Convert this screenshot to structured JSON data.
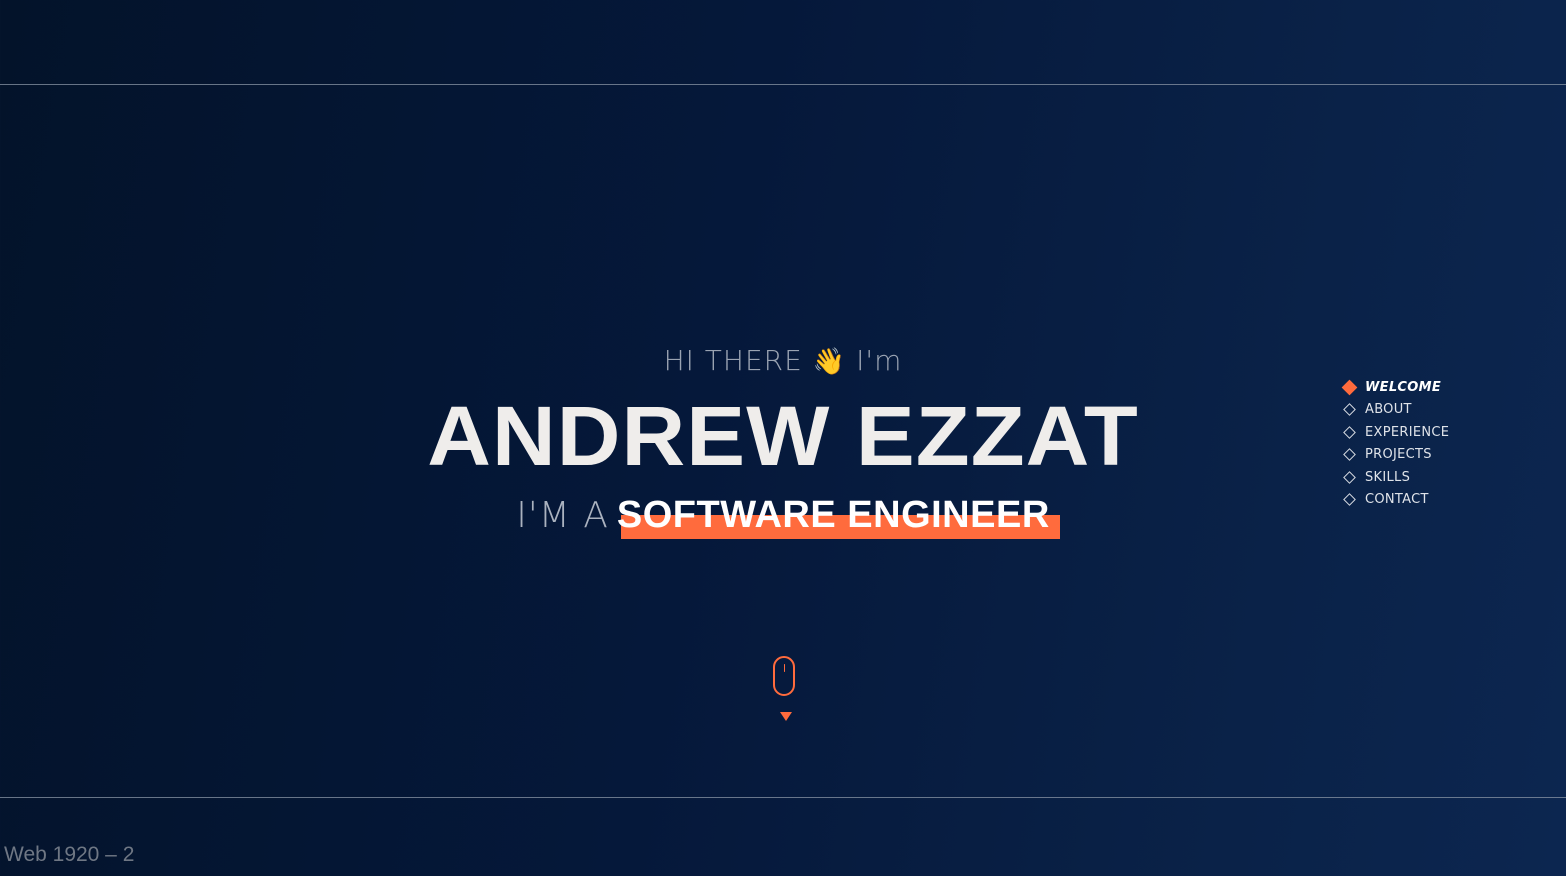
{
  "hero": {
    "greeting_prefix": "HI THERE",
    "greeting_emoji": "👋",
    "greeting_suffix": "I'm",
    "name": "ANDREW EZZAT",
    "role_prefix": "I'M A",
    "role": "SOFTWARE ENGINEER"
  },
  "nav": {
    "items": [
      {
        "label": "WELCOME",
        "active": true
      },
      {
        "label": "ABOUT",
        "active": false
      },
      {
        "label": "EXPERIENCE",
        "active": false
      },
      {
        "label": "PROJECTS",
        "active": false
      },
      {
        "label": "SKILLS",
        "active": false
      },
      {
        "label": "CONTACT",
        "active": false
      }
    ]
  },
  "frame": {
    "label": "Web 1920 – 2"
  },
  "colors": {
    "accent": "#ff6b3d",
    "background_start": "#03132a",
    "background_end": "#0c2650",
    "text": "#efedeb"
  },
  "icons": {
    "scroll": "mouse-scroll-icon",
    "scroll_arrow": "triangle-down-icon",
    "nav_marker": "diamond-icon"
  }
}
